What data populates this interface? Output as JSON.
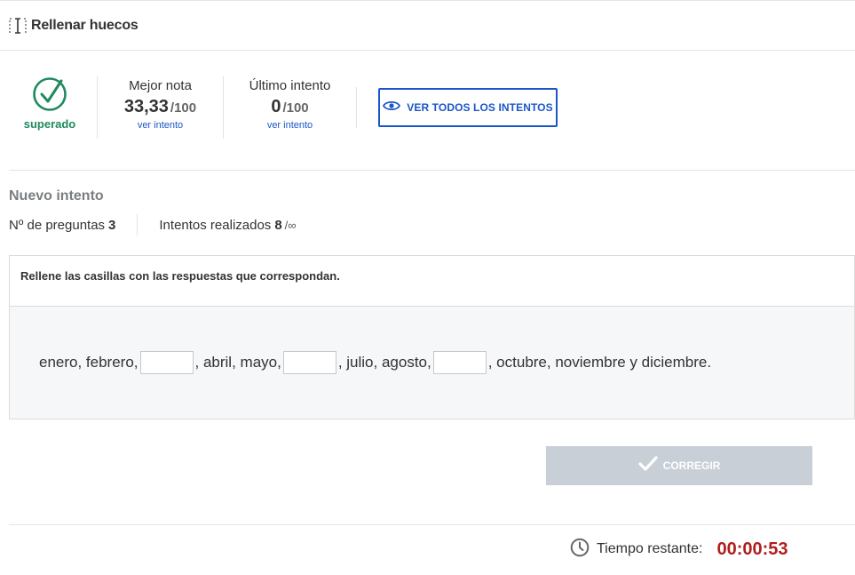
{
  "header": {
    "title": "Rellenar huecos",
    "icon": "text-cursor-icon"
  },
  "status": {
    "label": "superado",
    "icon": "check-circle-icon",
    "color": "#1f8a5e"
  },
  "best_score": {
    "title": "Mejor nota",
    "value": "33,33",
    "max": "/100",
    "link": "ver intento"
  },
  "last_attempt": {
    "title": "Último intento",
    "value": "0",
    "max": "/100",
    "link": "ver intento"
  },
  "all_attempts_button": {
    "label": "VER TODOS LOS INTENTOS",
    "icon": "eye-icon"
  },
  "new_attempt": {
    "title": "Nuevo intento",
    "questions_label": "Nº de preguntas",
    "questions_value": "3",
    "attempts_label": "Intentos realizados",
    "attempts_value": "8",
    "attempts_max": "/∞"
  },
  "question": {
    "instructions": "Rellene las casillas con las respuestas que correspondan.",
    "segments": [
      "enero, febrero,",
      ", abril, mayo,",
      ", julio, agosto,",
      ", octubre, noviembre y diciembre."
    ],
    "gaps": [
      {
        "value": ""
      },
      {
        "value": ""
      },
      {
        "value": ""
      }
    ]
  },
  "correct_button": {
    "label": "CORREGIR",
    "icon": "checkmark-icon"
  },
  "timer": {
    "label": "Tiempo restante:",
    "value": "00:00:53",
    "icon": "clock-icon"
  },
  "colors": {
    "accent": "#1a56c8",
    "success": "#1f8a5e",
    "timer": "#b01e1e",
    "disabled_button": "#c8cfd6"
  }
}
